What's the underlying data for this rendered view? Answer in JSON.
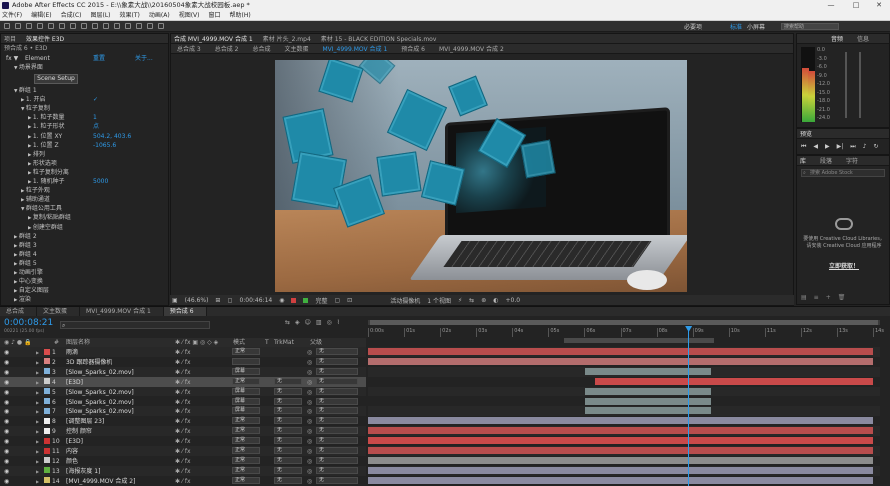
{
  "title": "Adobe After Effects CC 2015 - E:\\\\象素大战\\\\20160504象素大战校园板.aep *",
  "menu": [
    "文件(F)",
    "编辑(E)",
    "合成(C)",
    "图层(L)",
    "效果(T)",
    "动画(A)",
    "视图(V)",
    "窗口",
    "帮助(H)"
  ],
  "workspaces": [
    "必要项",
    "标准",
    "小屏幕"
  ],
  "search_placeholder": "搜索帮助",
  "effects": {
    "tabs": [
      "项目",
      "效果控件 E3D"
    ],
    "subtitle": "预合成 6 • E3D",
    "header": [
      "Element",
      "重置",
      "关于..."
    ],
    "scene_button": "Scene Setup",
    "rows": [
      {
        "label": "场景界面",
        "indent": 1,
        "tw": "open"
      },
      {
        "label": "群组 1",
        "indent": 1,
        "tw": "open"
      },
      {
        "label": "1. 开启",
        "indent": 2,
        "value": "✓"
      },
      {
        "label": "粒子复制",
        "indent": 2,
        "tw": "open"
      },
      {
        "label": "1. 粒子数量",
        "indent": 3,
        "value": "1"
      },
      {
        "label": "1. 粒子形状",
        "indent": 3,
        "value": "点"
      },
      {
        "label": "1. 位置 XY",
        "indent": 3,
        "value": "504.2, 403.6"
      },
      {
        "label": "1. 位置 Z",
        "indent": 3,
        "value": "-1065.6"
      },
      {
        "label": "排列",
        "indent": 3
      },
      {
        "label": "形状选项",
        "indent": 3
      },
      {
        "label": "粒子复制分离",
        "indent": 3
      },
      {
        "label": "1. 随机种子",
        "indent": 3,
        "value": "5000"
      },
      {
        "label": "粒子外观",
        "indent": 2
      },
      {
        "label": "辅助通道",
        "indent": 2
      },
      {
        "label": "群组公用工具",
        "indent": 2,
        "tw": "open"
      },
      {
        "label": "复制/粘贴群组",
        "indent": 3
      },
      {
        "label": "创建空群组",
        "indent": 3
      },
      {
        "label": "群组 2",
        "indent": 1
      },
      {
        "label": "群组 3",
        "indent": 1
      },
      {
        "label": "群组 4",
        "indent": 1
      },
      {
        "label": "群组 5",
        "indent": 1
      },
      {
        "label": "动画引擎",
        "indent": 1
      },
      {
        "label": "中心变换",
        "indent": 1
      },
      {
        "label": "自定义图层",
        "indent": 1
      },
      {
        "label": "渲染",
        "indent": 1
      }
    ]
  },
  "viewer": {
    "tabs": [
      "合成 MVI_4999.MOV 合成 1",
      "素材 片头_2.mp4",
      "素材 15 - BLACK EDITION Specials.mov"
    ],
    "comp_tabs": [
      "总合成 3",
      "总合成 2",
      "总合成",
      "文主数蛋",
      "MVI_4999.MOV 合成 1",
      "预合成 6",
      "MVI_4999.MOV 合成 2"
    ],
    "footer": {
      "zoom": "(46.6%)",
      "time": "0:00:46:14",
      "quality": "完整",
      "camera": "活动摄像机",
      "views": "1 个视图",
      "offset": "+0.0"
    }
  },
  "audio": {
    "tabs": [
      "音频",
      "信息"
    ],
    "scale": [
      "0.0",
      "-3.0",
      "-6.0",
      "-9.0",
      "-12.0",
      "-15.0",
      "-18.0",
      "-21.0",
      "-24.0"
    ],
    "levels": [
      0.72,
      0.68
    ]
  },
  "preview": {
    "title": "预览"
  },
  "libraries": {
    "tabs": [
      "库",
      "段落",
      "字符"
    ],
    "search": "搜索 Adobe Stock",
    "brand": "Creative Cloud",
    "message": "要使用 Creative Cloud Libraries，请安装 Creative Cloud 应用程序",
    "link": "立即获取！"
  },
  "timeline": {
    "tabs": [
      "总合成",
      "文主数蛋",
      "MVI_4999.MOV 合成 1",
      "预合成 6"
    ],
    "time": "0:00:08:21",
    "frames": "00221 (25.00 fps)",
    "search_placeholder": "",
    "col_headers": [
      "#",
      "图层名称",
      "模式",
      "T",
      "TrkMat",
      "父级"
    ],
    "ruler": [
      "0:00s",
      "01s",
      "02s",
      "03s",
      "04s",
      "05s",
      "06s",
      "07s",
      "08s",
      "09s",
      "10s",
      "11s",
      "12s",
      "13s",
      "14s"
    ],
    "playhead": 0.634,
    "layers": [
      {
        "num": "1",
        "name": "雨滴",
        "color": "#d94c4c",
        "mode": "正常",
        "trk": "",
        "parent": "无",
        "bar": [
          0,
          1
        ],
        "bar_color": "#b84d4d",
        "sel": false
      },
      {
        "num": "2",
        "name": "3D 跟踪器摄像机",
        "color": "#d98080",
        "mode": "",
        "trk": "",
        "parent": "无",
        "bar": [
          0,
          1
        ],
        "bar_color": "#b46d6d",
        "sel": false
      },
      {
        "num": "3",
        "name": "[Slow_Sparks_02.mov]",
        "color": "#7fb0d9",
        "mode": "屏幕",
        "trk": "",
        "parent": "无",
        "bar": [
          0.43,
          0.68
        ],
        "bar_color": "#7a8a8a",
        "sel": false
      },
      {
        "num": "4",
        "name": "[E3D]",
        "color": "#cccccc",
        "mode": "正常",
        "trk": "无",
        "parent": "无",
        "bar": [
          0.45,
          1
        ],
        "bar_color": "#c94a4a",
        "sel": true
      },
      {
        "num": "5",
        "name": "[Slow_Sparks_02.mov]",
        "color": "#7fb0d9",
        "mode": "屏幕",
        "trk": "无",
        "parent": "无",
        "bar": [
          0.43,
          0.68
        ],
        "bar_color": "#7a8a8a",
        "sel": false
      },
      {
        "num": "6",
        "name": "[Slow_Sparks_02.mov]",
        "color": "#7fb0d9",
        "mode": "屏幕",
        "trk": "无",
        "parent": "无",
        "bar": [
          0.43,
          0.68
        ],
        "bar_color": "#7a8a8a",
        "sel": false
      },
      {
        "num": "7",
        "name": "[Slow_Sparks_02.mov]",
        "color": "#7fb0d9",
        "mode": "屏幕",
        "trk": "无",
        "parent": "无",
        "bar": [
          0.43,
          0.68
        ],
        "bar_color": "#7a8a8a",
        "sel": false
      },
      {
        "num": "8",
        "name": "[调整图层 23]",
        "color": "#eeeeee",
        "mode": "正常",
        "trk": "无",
        "parent": "无",
        "bar": [
          0,
          1
        ],
        "bar_color": "#8a8aa0",
        "sel": false
      },
      {
        "num": "9",
        "name": "控制 颜帘",
        "color": "#eeeeee",
        "mode": "正常",
        "trk": "无",
        "parent": "无",
        "bar": [
          0,
          1
        ],
        "bar_color": "#b84d4d",
        "sel": false
      },
      {
        "num": "10",
        "name": "[E3D]",
        "color": "#cc3333",
        "mode": "正常",
        "trk": "无",
        "parent": "无",
        "bar": [
          0,
          1
        ],
        "bar_color": "#c94a4a",
        "sel": false
      },
      {
        "num": "11",
        "name": "内容",
        "color": "#cc3333",
        "mode": "正常",
        "trk": "无",
        "parent": "无",
        "bar": [
          0,
          1
        ],
        "bar_color": "#b84d4d",
        "sel": false
      },
      {
        "num": "12",
        "name": "颜色",
        "color": "#cccccc",
        "mode": "正常",
        "trk": "无",
        "parent": "无",
        "bar": [
          0,
          1
        ],
        "bar_color": "#8c8c8c",
        "sel": false
      },
      {
        "num": "13",
        "name": "[海报灰度 1]",
        "color": "#60b040",
        "mode": "正常",
        "trk": "无",
        "parent": "无",
        "bar": [
          0,
          1
        ],
        "bar_color": "#8a8aa0",
        "sel": false
      },
      {
        "num": "14",
        "name": "[MVI_4999.MOV 合成 2]",
        "color": "#d4c066",
        "mode": "正常",
        "trk": "无",
        "parent": "无",
        "bar": [
          0,
          1
        ],
        "bar_color": "#8a8aa0",
        "sel": false
      }
    ]
  }
}
